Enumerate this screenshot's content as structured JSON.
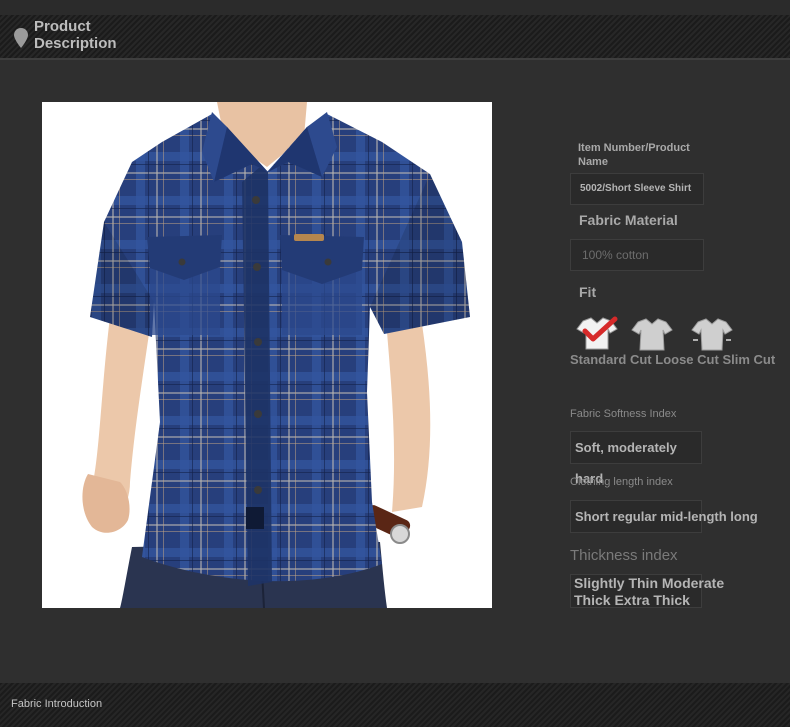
{
  "header": {
    "title": "Product Description",
    "icon": "location-pin-icon"
  },
  "image": {
    "alt": "model-wearing-blue-plaid-short-sleeve-shirt"
  },
  "specs": {
    "item_label": "Item Number/Product Name",
    "item_value": "5002/Short Sleeve Shirt",
    "fabric_label": "Fabric Material",
    "fabric_value": "100% cotton",
    "fit_label": "Fit",
    "fit_options": [
      "Standard Cut",
      "Loose Cut",
      "Slim Cut"
    ],
    "fit_selected": "Standard Cut",
    "softness_label": "Fabric Softness Index",
    "softness_value": "Soft, moderately hard",
    "length_label": "Clothing length index",
    "length_value": "Short regular mid-length long",
    "thickness_label": "Thickness index",
    "thickness_value": "Slightly Thin Moderate Thick Extra Thick"
  },
  "footer": {
    "title": "Fabric Introduction"
  },
  "colors": {
    "background": "#2f2f2f",
    "accent": "#d62a2a",
    "shirt": "#27407a"
  }
}
